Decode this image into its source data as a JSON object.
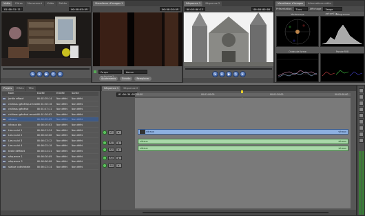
{
  "viewer": {
    "tabs": [
      "Vidéo",
      "Filtres",
      "Mouvement",
      "Vidéo",
      "Stéréo"
    ],
    "timecode_left": "01:00:51:11",
    "timecode_right": "00:00:05:09"
  },
  "canvas": {
    "tabs": [
      "Visualiseur d'images 1"
    ],
    "timecode_right": "00:00:36:09",
    "options": [
      "Corps principal",
      "Aucun",
      "Ajustements",
      "Échelle",
      "Remplacer"
    ]
  },
  "canvas2": {
    "tabs": [
      "Séquence 1",
      "Séquence 2"
    ],
    "timecode_left": "00:05:06:13",
    "timecode_right": "00:00:00:00"
  },
  "scopes": {
    "tabs": [
      "Visualiseur d'images",
      "Informations vidéo"
    ],
    "presentation_label": "Présentation",
    "presentation_value": "Tous",
    "display_label": "Affichage",
    "display_value": "Image actuelle",
    "labels": [
      "Vectorscope",
      "Histogramme",
      "Ondes de forme",
      "Parade RVB"
    ]
  },
  "browser": {
    "tabs": [
      "Projets",
      "Effets",
      "Tête"
    ],
    "columns": [
      "Nom",
      "Durée",
      "Entrée",
      "Sortie"
    ],
    "rows": [
      {
        "name": "jardin effacé",
        "dur": "00:02:39:14",
        "in": "Non défini",
        "out": "Non défini"
      },
      {
        "name": "château générique texte",
        "dur": "00:01:36:10",
        "in": "Non défini",
        "out": "Non défini"
      },
      {
        "name": "château général",
        "dur": "00:01:47:11",
        "in": "Non défini",
        "out": "Non défini"
      },
      {
        "name": "château général recadré",
        "dur": "00:01:50:02",
        "in": "Non défini",
        "out": "Non défini"
      },
      {
        "name": "vitraux",
        "dur": "00:00:05:09",
        "in": "Non défini",
        "out": "Non défini"
      },
      {
        "name": "vitraux bis",
        "dur": "00:00:26:03",
        "in": "Non défini",
        "out": "Non défini"
      },
      {
        "name": "Lieu suivi 1",
        "dur": "00:00:11:24",
        "in": "Non défini",
        "out": "Non défini"
      },
      {
        "name": "Lieu suivi 2",
        "dur": "00:00:18:06",
        "in": "Non défini",
        "out": "Non défini"
      },
      {
        "name": "Lieu suivi 3",
        "dur": "00:00:13:12",
        "in": "Non défini",
        "out": "Non défini"
      },
      {
        "name": "Lieu suivi 4",
        "dur": "00:00:25:10",
        "in": "Non défini",
        "out": "Non défini"
      },
      {
        "name": "texte défilant",
        "dur": "00:00:14:21",
        "in": "Non défini",
        "out": "Non défini"
      },
      {
        "name": "séquence 1",
        "dur": "00:00:36:09",
        "in": "Non défini",
        "out": "Non défini"
      },
      {
        "name": "séquence 2",
        "dur": "00:00:00:00",
        "in": "Non défini",
        "out": "Non défini"
      },
      {
        "name": "statue cathédrale",
        "dur": "00:00:23:14",
        "in": "Non défini",
        "out": "Non défini"
      }
    ],
    "selected_index": 4
  },
  "timeline": {
    "tabs": [
      "Séquence 1",
      "Séquence 2"
    ],
    "timecode": "01:00:36:09",
    "ruler": [
      "00:00",
      "00:01:00:00",
      "00:01:30:00",
      "00:02:00:00"
    ],
    "tracks": [
      {
        "label": "V1",
        "clip": "vitraux",
        "end": "vitraux",
        "type": "video"
      },
      {
        "label": "A1",
        "clip": "vitraux",
        "end": "vitraux",
        "type": "audio"
      },
      {
        "label": "A2",
        "clip": "vitraux",
        "end": "vitraux",
        "type": "audio"
      },
      {
        "label": "A3",
        "clip": "",
        "end": "",
        "type": "empty"
      },
      {
        "label": "A4",
        "clip": "",
        "end": "",
        "type": "empty"
      }
    ]
  },
  "colors": {
    "selection": "#3e5a86",
    "video_clip": "#8db0e0",
    "audio_clip": "#a9d8a9"
  }
}
